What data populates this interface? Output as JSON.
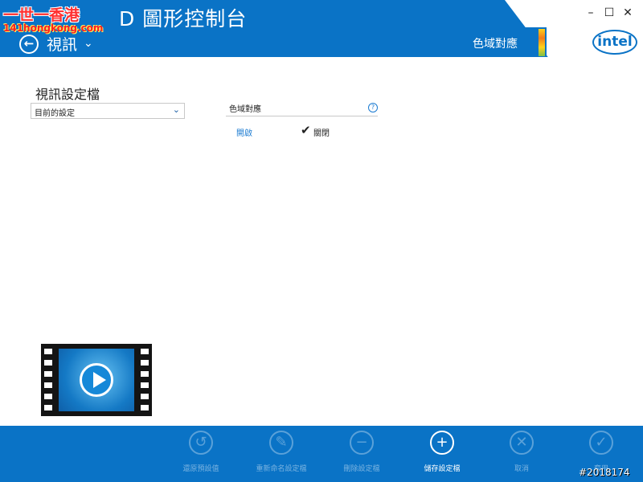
{
  "header": {
    "app_title_visible": "D 圖形控制台",
    "section_title": "視訊",
    "color_gamut_tab": "色域對應",
    "logo_text": "intel"
  },
  "window": {
    "minimize": "–",
    "maximize": "☐",
    "close": "✕"
  },
  "watermark": {
    "top": "一世一香港",
    "bottom": "141hongkong.com"
  },
  "main": {
    "profile_label": "視訊設定檔",
    "profile_value": "目前的設定",
    "color_field_label": "色域對應",
    "help": "?",
    "option_on": "開啟",
    "option_off": "關閉",
    "selected_option": "關閉"
  },
  "footer": {
    "actions": [
      {
        "label": "還原預設值",
        "icon": "↺",
        "icon_name": "restore-icon",
        "enabled": false
      },
      {
        "label": "重新命名設定檔",
        "icon": "✎",
        "icon_name": "pencil-icon",
        "enabled": false
      },
      {
        "label": "刪除設定檔",
        "icon": "−",
        "icon_name": "minus-icon",
        "enabled": false
      },
      {
        "label": "儲存設定檔",
        "icon": "+",
        "icon_name": "plus-icon",
        "enabled": true
      },
      {
        "label": "取消",
        "icon": "✕",
        "icon_name": "cancel-icon",
        "enabled": false
      },
      {
        "label": "套用",
        "icon": "✓",
        "icon_name": "check-icon",
        "enabled": false
      }
    ]
  },
  "stamp": "#2018174",
  "colors": {
    "accent": "#0a73c6",
    "link": "#1b7bd1"
  }
}
